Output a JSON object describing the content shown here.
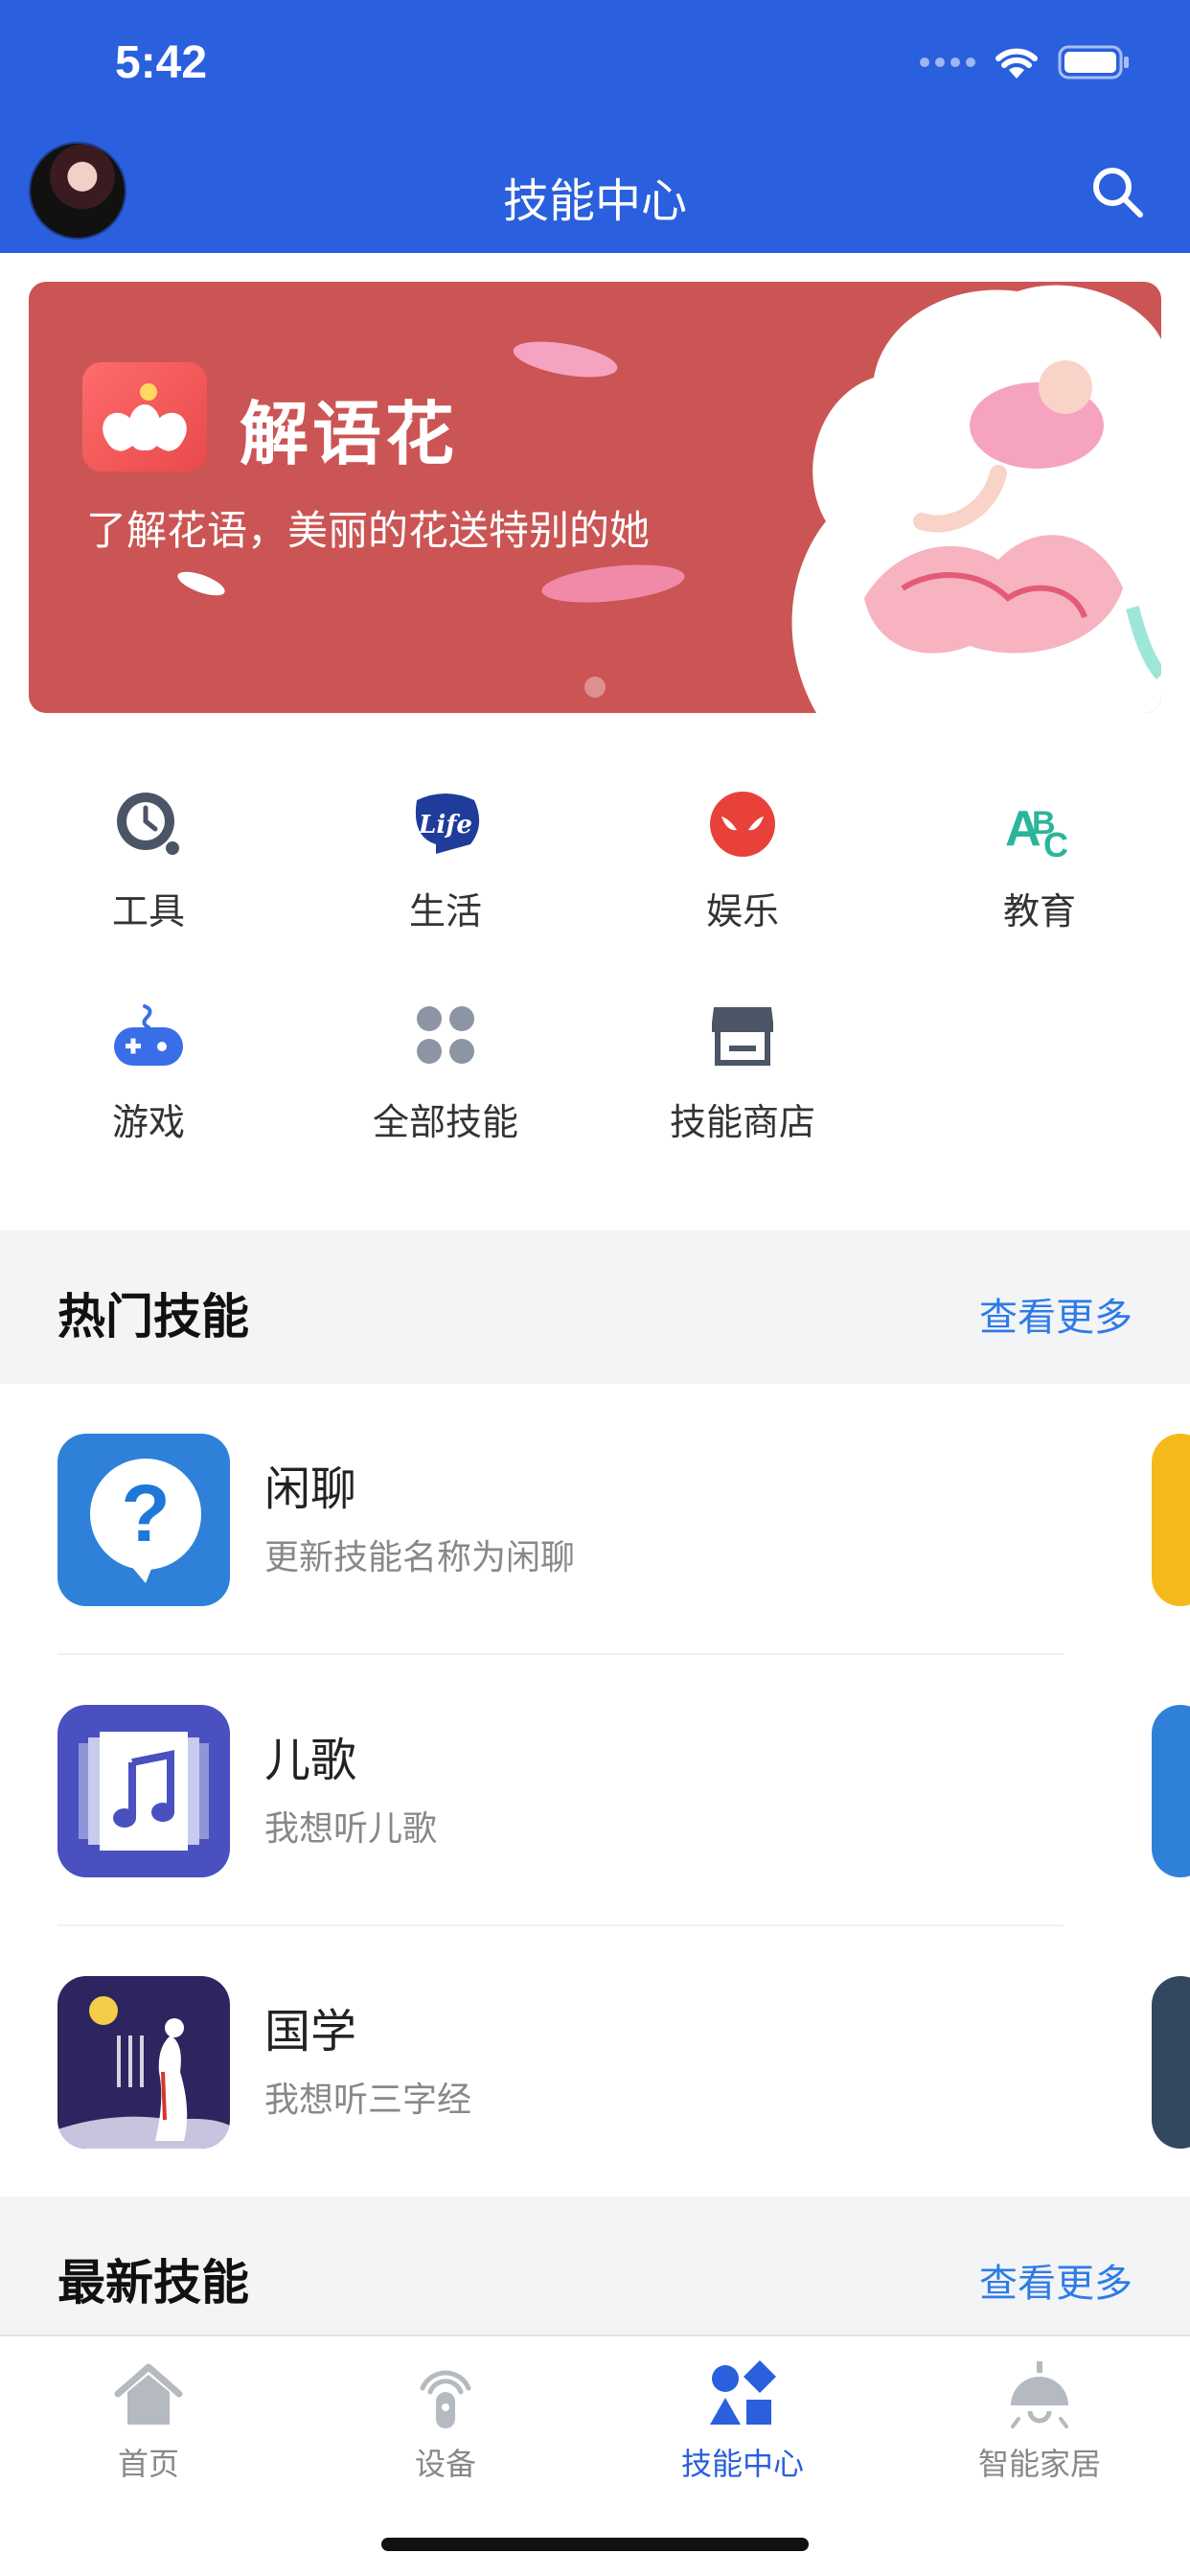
{
  "status_bar": {
    "time": "5:42"
  },
  "header": {
    "title": "技能中心"
  },
  "banner": {
    "title": "解语花",
    "subtitle": "了解花语，美丽的花送特别的她"
  },
  "categories": [
    {
      "label": "工具",
      "icon": "clock-tool-icon",
      "color": "#4b5565"
    },
    {
      "label": "生活",
      "icon": "life-icon",
      "color": "#1f3c9a"
    },
    {
      "label": "娱乐",
      "icon": "mask-icon",
      "color": "#e8413a"
    },
    {
      "label": "教育",
      "icon": "abc-icon",
      "color": "#2bb59a"
    },
    {
      "label": "游戏",
      "icon": "gamepad-icon",
      "color": "#3a6ee8"
    },
    {
      "label": "全部技能",
      "icon": "grid-dots-icon",
      "color": "#8c95a3"
    },
    {
      "label": "技能商店",
      "icon": "store-icon",
      "color": "#4b5565"
    }
  ],
  "hot_section": {
    "title": "热门技能",
    "more": "查看更多"
  },
  "skills": [
    {
      "name": "闲聊",
      "desc": "更新技能名称为闲聊",
      "icon": "chat-question-icon"
    },
    {
      "name": "儿歌",
      "desc": "我想听儿歌",
      "icon": "music-note-icon"
    },
    {
      "name": "国学",
      "desc": "我想听三字经",
      "icon": "classical-figure-icon"
    }
  ],
  "new_section": {
    "title": "最新技能",
    "more": "查看更多"
  },
  "tabs": [
    {
      "label": "首页",
      "icon": "home-icon",
      "active": false
    },
    {
      "label": "设备",
      "icon": "device-icon",
      "active": false
    },
    {
      "label": "技能中心",
      "icon": "skills-shapes-icon",
      "active": true
    },
    {
      "label": "智能家居",
      "icon": "lamp-icon",
      "active": false
    }
  ],
  "colors": {
    "brand": "#2a5fdd",
    "link": "#2e7be6",
    "banner": "#cb5554"
  }
}
